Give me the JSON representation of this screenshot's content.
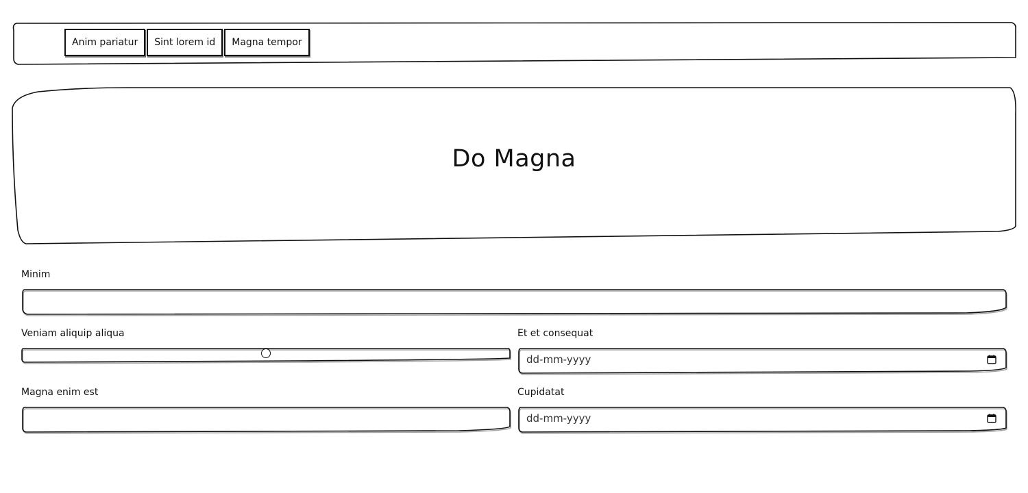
{
  "nav": {
    "tabs": [
      "Anim pariatur",
      "Sint lorem id",
      "Magna tempor"
    ]
  },
  "hero": {
    "title": "Do Magna"
  },
  "form": {
    "minim": {
      "label": "Minim",
      "value": ""
    },
    "veniam": {
      "label": "Veniam aliquip aliqua",
      "slider_value_fraction": 0.5
    },
    "et_et": {
      "label": "Et et consequat",
      "placeholder": "dd-mm-yyyy"
    },
    "magna_enim": {
      "label": "Magna enim est",
      "value": ""
    },
    "cupidatat": {
      "label": "Cupidatat",
      "placeholder": "dd-mm-yyyy"
    }
  }
}
